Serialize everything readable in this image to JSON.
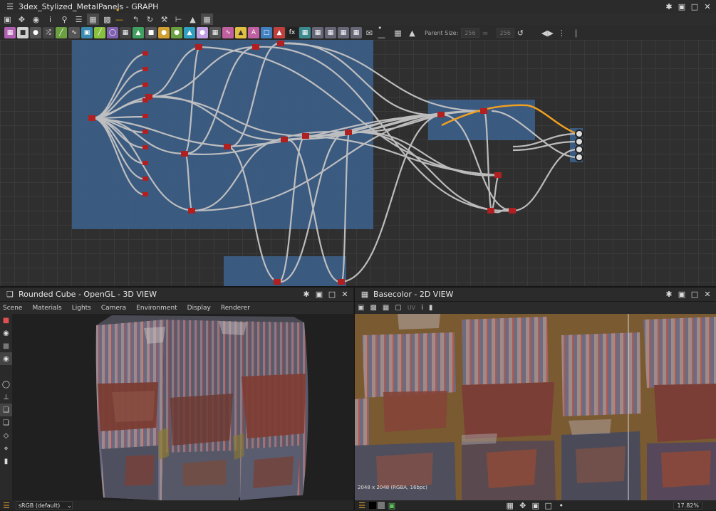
{
  "graph": {
    "title": "3dex_Stylized_MetalPanels - GRAPH",
    "parent_size_label": "Parent Size:",
    "parent_size_value": "256",
    "size_value_2": "256",
    "node_icons": [
      "bitmap",
      "uniform-color",
      "blend",
      "levels",
      "curve",
      "transform",
      "gradient",
      "warp",
      "blur",
      "histogram",
      "shape",
      "tile-generator",
      "noise",
      "pattern",
      "normal",
      "ao",
      "text",
      "frame",
      "fx-map",
      "pixel-processor"
    ],
    "colors": {
      "frame": "#3d5f88",
      "connection": "#c4c4c4",
      "orange_connection": "#f0a020",
      "node_output": "#b02020"
    }
  },
  "view3d": {
    "title": "Rounded Cube - OpenGL - 3D VIEW",
    "menu": [
      "Scene",
      "Materials",
      "Lights",
      "Camera",
      "Environment",
      "Display",
      "Renderer"
    ],
    "colorspace": "sRGB (default)"
  },
  "view2d": {
    "title": "Basecolor - 2D VIEW",
    "uv_label": "UV",
    "info": "2048 x 2048 (RGBA, 16bpc)",
    "zoom": "17.82%"
  }
}
